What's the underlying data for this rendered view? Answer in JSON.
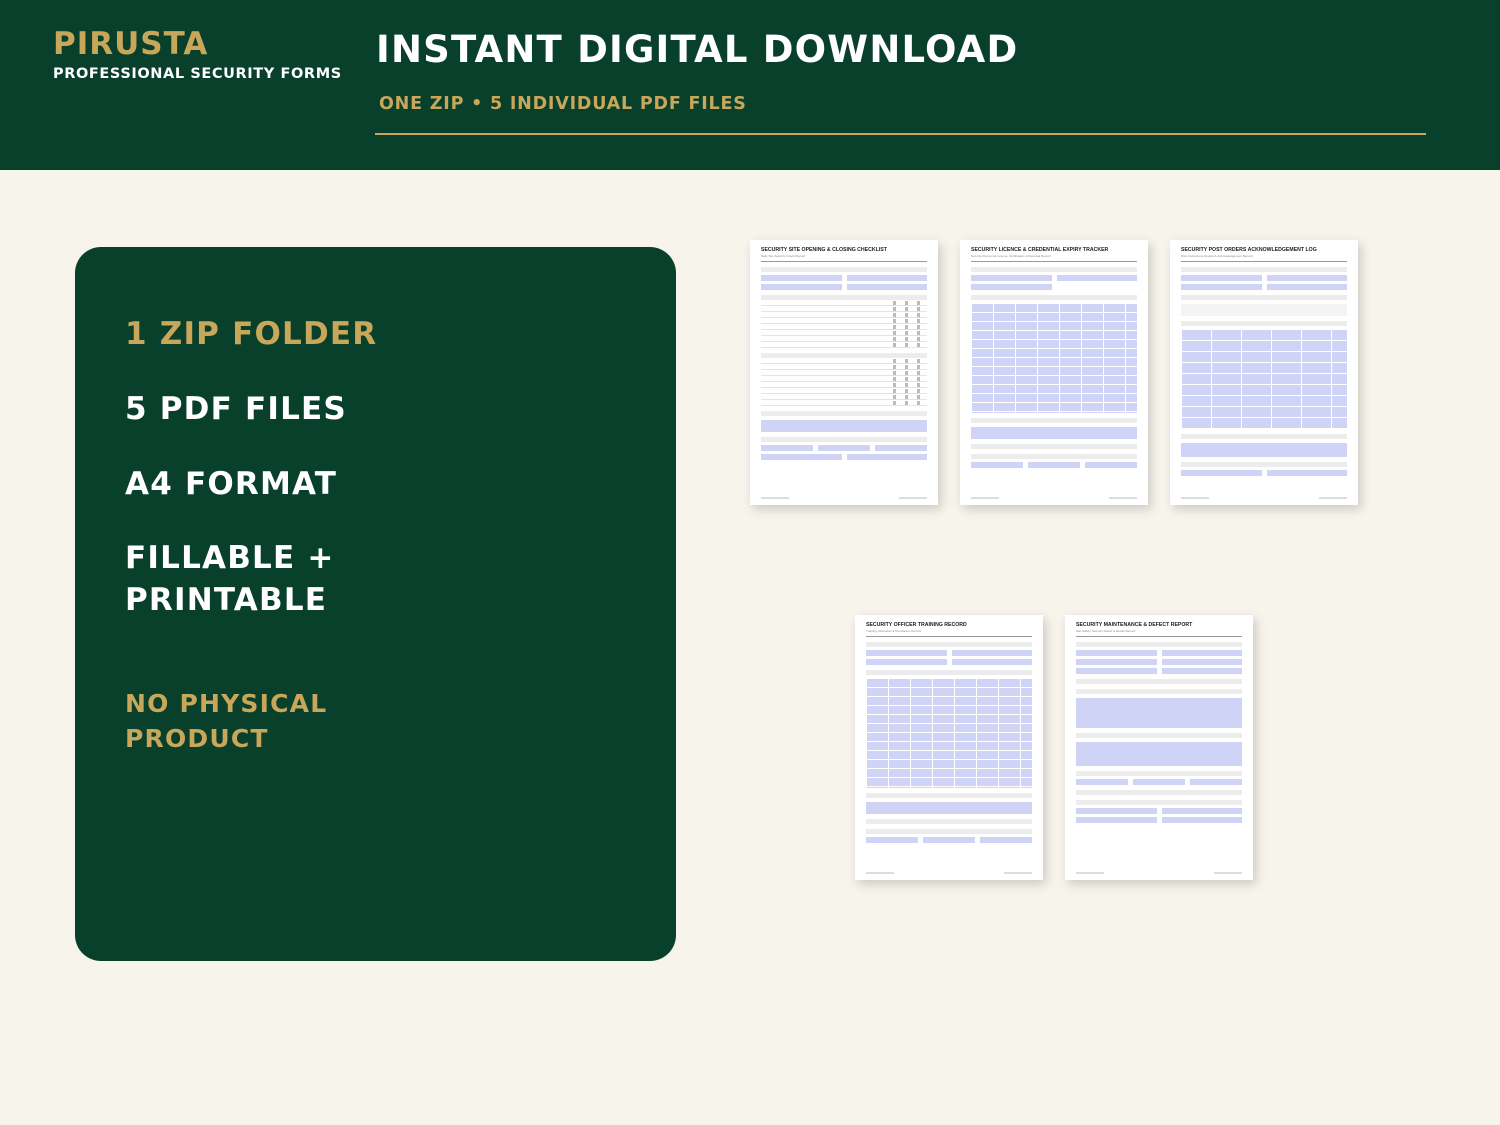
{
  "brand": {
    "name": "PIRUSTA",
    "subtitle": "PROFESSIONAL SECURITY FORMS"
  },
  "hero": {
    "title": "INSTANT DIGITAL DOWNLOAD",
    "subtitle": "ONE ZIP • 5 INDIVIDUAL PDF FILES"
  },
  "features": [
    "1 ZIP FOLDER",
    "5 PDF FILES",
    "A4 FORMAT",
    "FILLABLE +",
    "PRINTABLE",
    "NO PHYSICAL",
    "PRODUCT"
  ],
  "forms": [
    {
      "title": "SECURITY SITE OPENING & CLOSING CHECKLIST",
      "subtitle": "Daily Site Security Check Record"
    },
    {
      "title": "SECURITY LICENCE & CREDENTIAL EXPIRY TRACKER",
      "subtitle": "Security Personnel Licence, Certification & Renewal Record"
    },
    {
      "title": "SECURITY POST ORDERS ACKNOWLEDGEMENT LOG",
      "subtitle": "Post Instructions Review & Acknowledgement Record"
    },
    {
      "title": "SECURITY OFFICER TRAINING RECORD",
      "subtitle": "Training, Refresher & Completion Record"
    },
    {
      "title": "SECURITY MAINTENANCE & DEFECT REPORT",
      "subtitle": "Site Safety, Security Defect & Repair Record"
    }
  ],
  "colors": {
    "primary": "#08402b",
    "accent": "#c9a75a",
    "background": "#f7f4ec",
    "field": "#cfd4f6"
  }
}
